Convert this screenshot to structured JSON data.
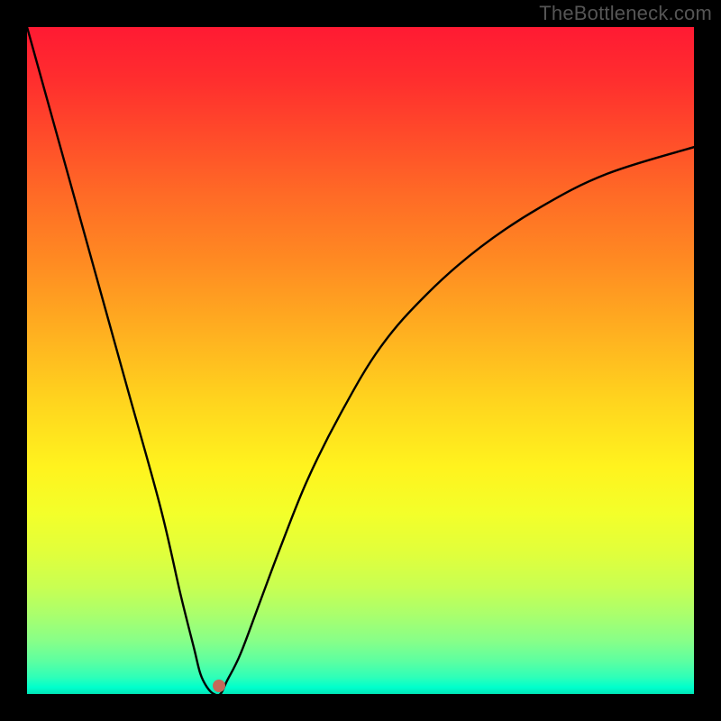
{
  "watermark": "TheBottleneck.com",
  "chart_data": {
    "type": "line",
    "title": "",
    "xlabel": "",
    "ylabel": "",
    "xlim": [
      0,
      100
    ],
    "ylim": [
      0,
      100
    ],
    "grid": false,
    "series": [
      {
        "name": "curve",
        "x": [
          0,
          5,
          10,
          15,
          20,
          23,
          25,
          26,
          27,
          28,
          29,
          30,
          32,
          35,
          38,
          42,
          47,
          53,
          60,
          68,
          77,
          87,
          100
        ],
        "values": [
          100,
          82,
          64,
          46,
          28,
          15,
          7,
          3,
          1,
          0,
          0,
          2,
          6,
          14,
          22,
          32,
          42,
          52,
          60,
          67,
          73,
          78,
          82
        ]
      }
    ],
    "marker": {
      "x": 28.8,
      "y": 1.2,
      "color": "#c46a5a"
    },
    "gradient": {
      "top": "#ff1a33",
      "mid": "#ffd41e",
      "bottom": "#00e6b8"
    }
  }
}
